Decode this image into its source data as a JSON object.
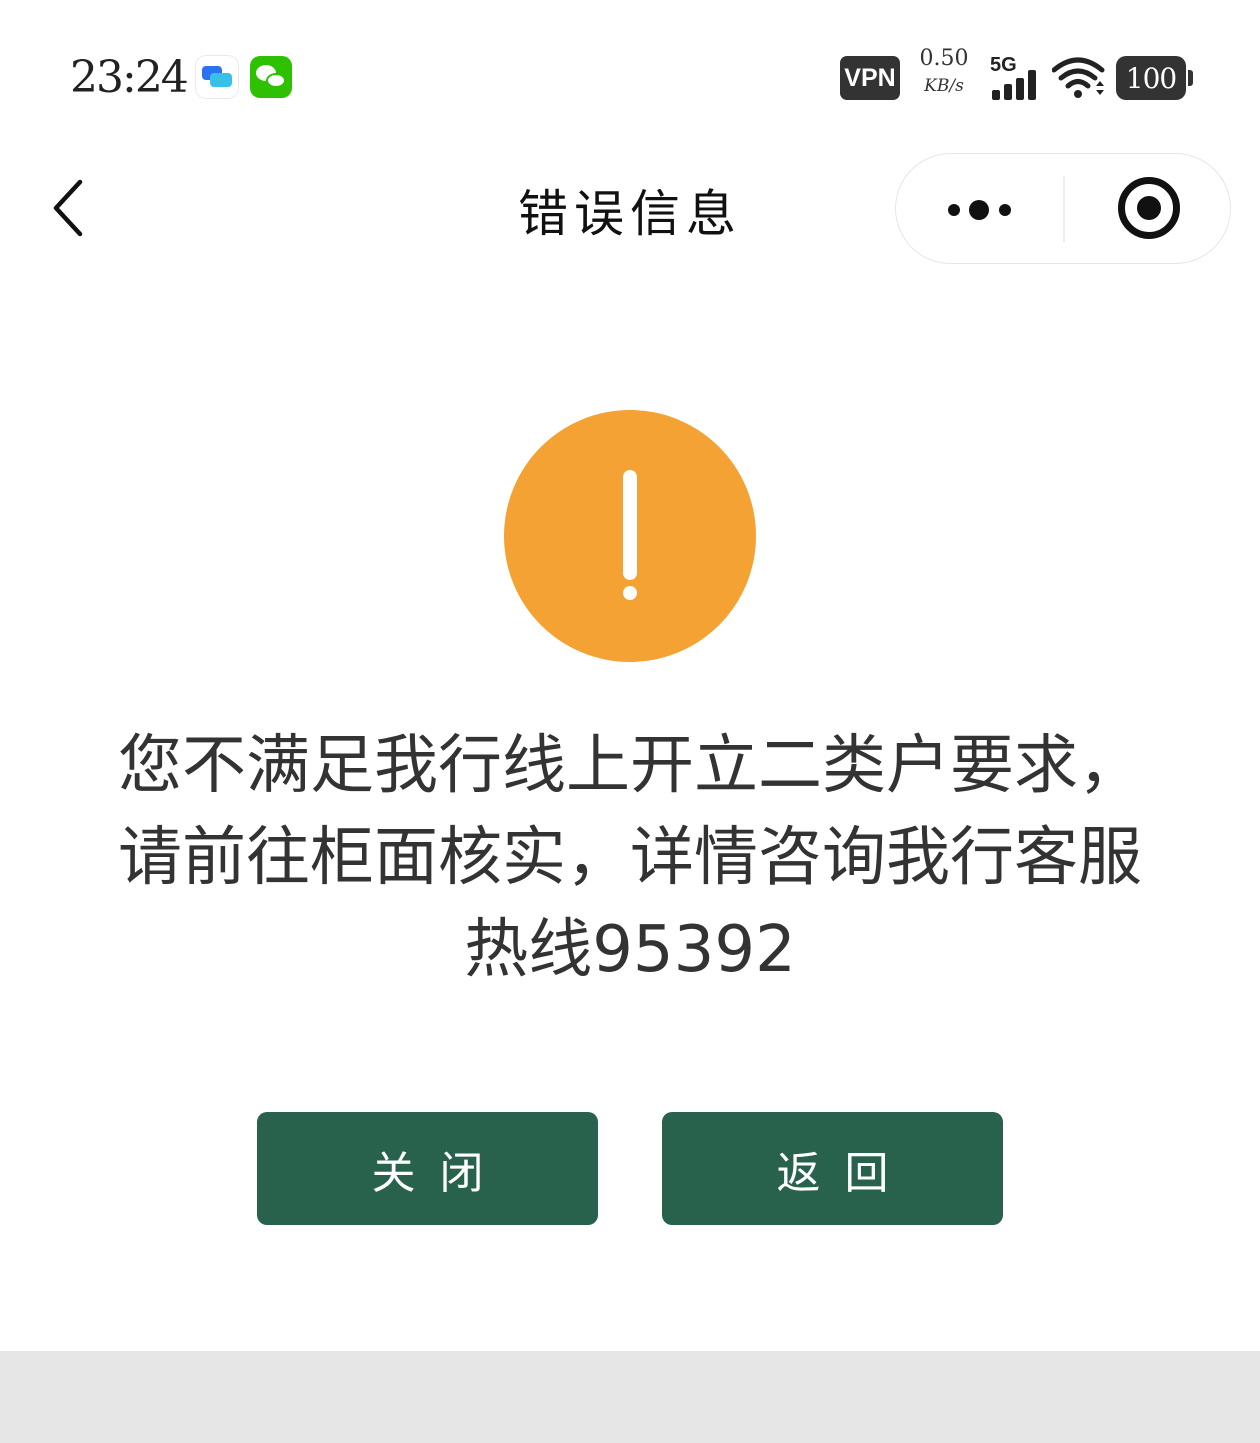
{
  "status_bar": {
    "time": "23:24",
    "vpn_label": "VPN",
    "net_speed_value": "0.50",
    "net_speed_unit": "KB/s",
    "network_type": "5G",
    "battery_level": "100"
  },
  "nav": {
    "title": "错误信息"
  },
  "alert": {
    "icon_color": "#f5a234",
    "message": "您不满足我行线上开立二类户要求，请前往柜面核实，详情咨询我行客服热线95392"
  },
  "actions": {
    "close_label": "关闭",
    "return_label": "返回",
    "button_color": "#28614c"
  }
}
